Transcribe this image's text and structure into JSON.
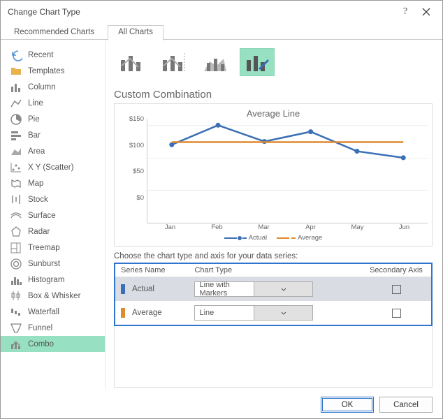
{
  "window": {
    "title": "Change Chart Type"
  },
  "tabs": {
    "recommended": "Recommended Charts",
    "all": "All Charts"
  },
  "sidebar": {
    "items": [
      {
        "label": "Recent",
        "icon": "undo"
      },
      {
        "label": "Templates",
        "icon": "folder"
      },
      {
        "label": "Column",
        "icon": "column"
      },
      {
        "label": "Line",
        "icon": "line"
      },
      {
        "label": "Pie",
        "icon": "pie"
      },
      {
        "label": "Bar",
        "icon": "bar"
      },
      {
        "label": "Area",
        "icon": "area"
      },
      {
        "label": "X Y (Scatter)",
        "icon": "scatter"
      },
      {
        "label": "Map",
        "icon": "map"
      },
      {
        "label": "Stock",
        "icon": "stock"
      },
      {
        "label": "Surface",
        "icon": "surface"
      },
      {
        "label": "Radar",
        "icon": "radar"
      },
      {
        "label": "Treemap",
        "icon": "treemap"
      },
      {
        "label": "Sunburst",
        "icon": "sunburst"
      },
      {
        "label": "Histogram",
        "icon": "histogram"
      },
      {
        "label": "Box & Whisker",
        "icon": "boxwhisker"
      },
      {
        "label": "Waterfall",
        "icon": "waterfall"
      },
      {
        "label": "Funnel",
        "icon": "funnel"
      },
      {
        "label": "Combo",
        "icon": "combo"
      }
    ]
  },
  "subtitle": "Custom Combination",
  "chart_data": {
    "type": "line",
    "title": "Average Line",
    "xlabel": "",
    "ylabel": "",
    "categories": [
      "Jan",
      "Feb",
      "Mar",
      "Apr",
      "May",
      "Jun"
    ],
    "ylim": [
      0,
      160
    ],
    "yticks": [
      "$150",
      "$100",
      "$50",
      "$0"
    ],
    "series": [
      {
        "name": "Actual",
        "type": "line_markers",
        "color": "#3b6fb6",
        "values": [
          120,
          150,
          125,
          140,
          110,
          100
        ]
      },
      {
        "name": "Average",
        "type": "line",
        "color": "#e08a2e",
        "values": [
          124,
          124,
          124,
          124,
          124,
          124
        ]
      }
    ]
  },
  "seriesPanel": {
    "instruction": "Choose the chart type and axis for your data series:",
    "headers": {
      "name": "Series Name",
      "type": "Chart Type",
      "axis": "Secondary Axis"
    },
    "rows": [
      {
        "color": "#3b6fb6",
        "name": "Actual",
        "chartType": "Line with Markers",
        "secondary": false
      },
      {
        "color": "#e08a2e",
        "name": "Average",
        "chartType": "Line",
        "secondary": false
      }
    ]
  },
  "footer": {
    "ok": "OK",
    "cancel": "Cancel"
  }
}
